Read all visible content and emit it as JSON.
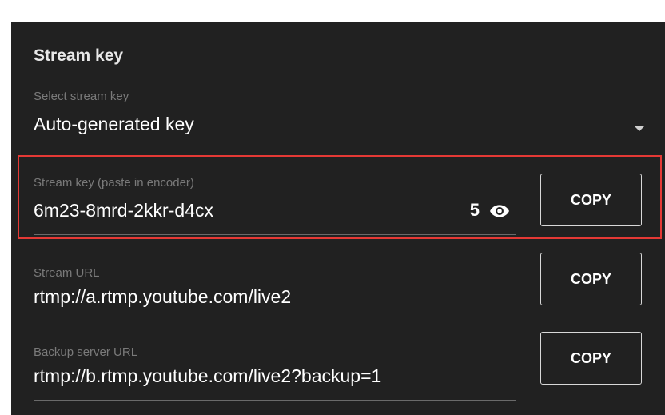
{
  "section": {
    "title": "Stream key"
  },
  "select_key": {
    "label": "Select stream key",
    "value": "Auto-generated key"
  },
  "stream_key": {
    "label": "Stream key (paste in encoder)",
    "value": "6m23-8mrd-2kkr-d4cx",
    "count": "5",
    "copy_label": "COPY"
  },
  "stream_url": {
    "label": "Stream URL",
    "value": "rtmp://a.rtmp.youtube.com/live2",
    "copy_label": "COPY"
  },
  "backup_url": {
    "label": "Backup server URL",
    "value": "rtmp://b.rtmp.youtube.com/live2?backup=1",
    "copy_label": "COPY"
  },
  "colors": {
    "panel_bg": "#212121",
    "highlight_border": "#e53935",
    "label_text": "#7a7a7a",
    "value_text": "#ffffff"
  },
  "icons": {
    "visibility": "eye-icon",
    "dropdown": "dropdown-arrow-icon"
  }
}
